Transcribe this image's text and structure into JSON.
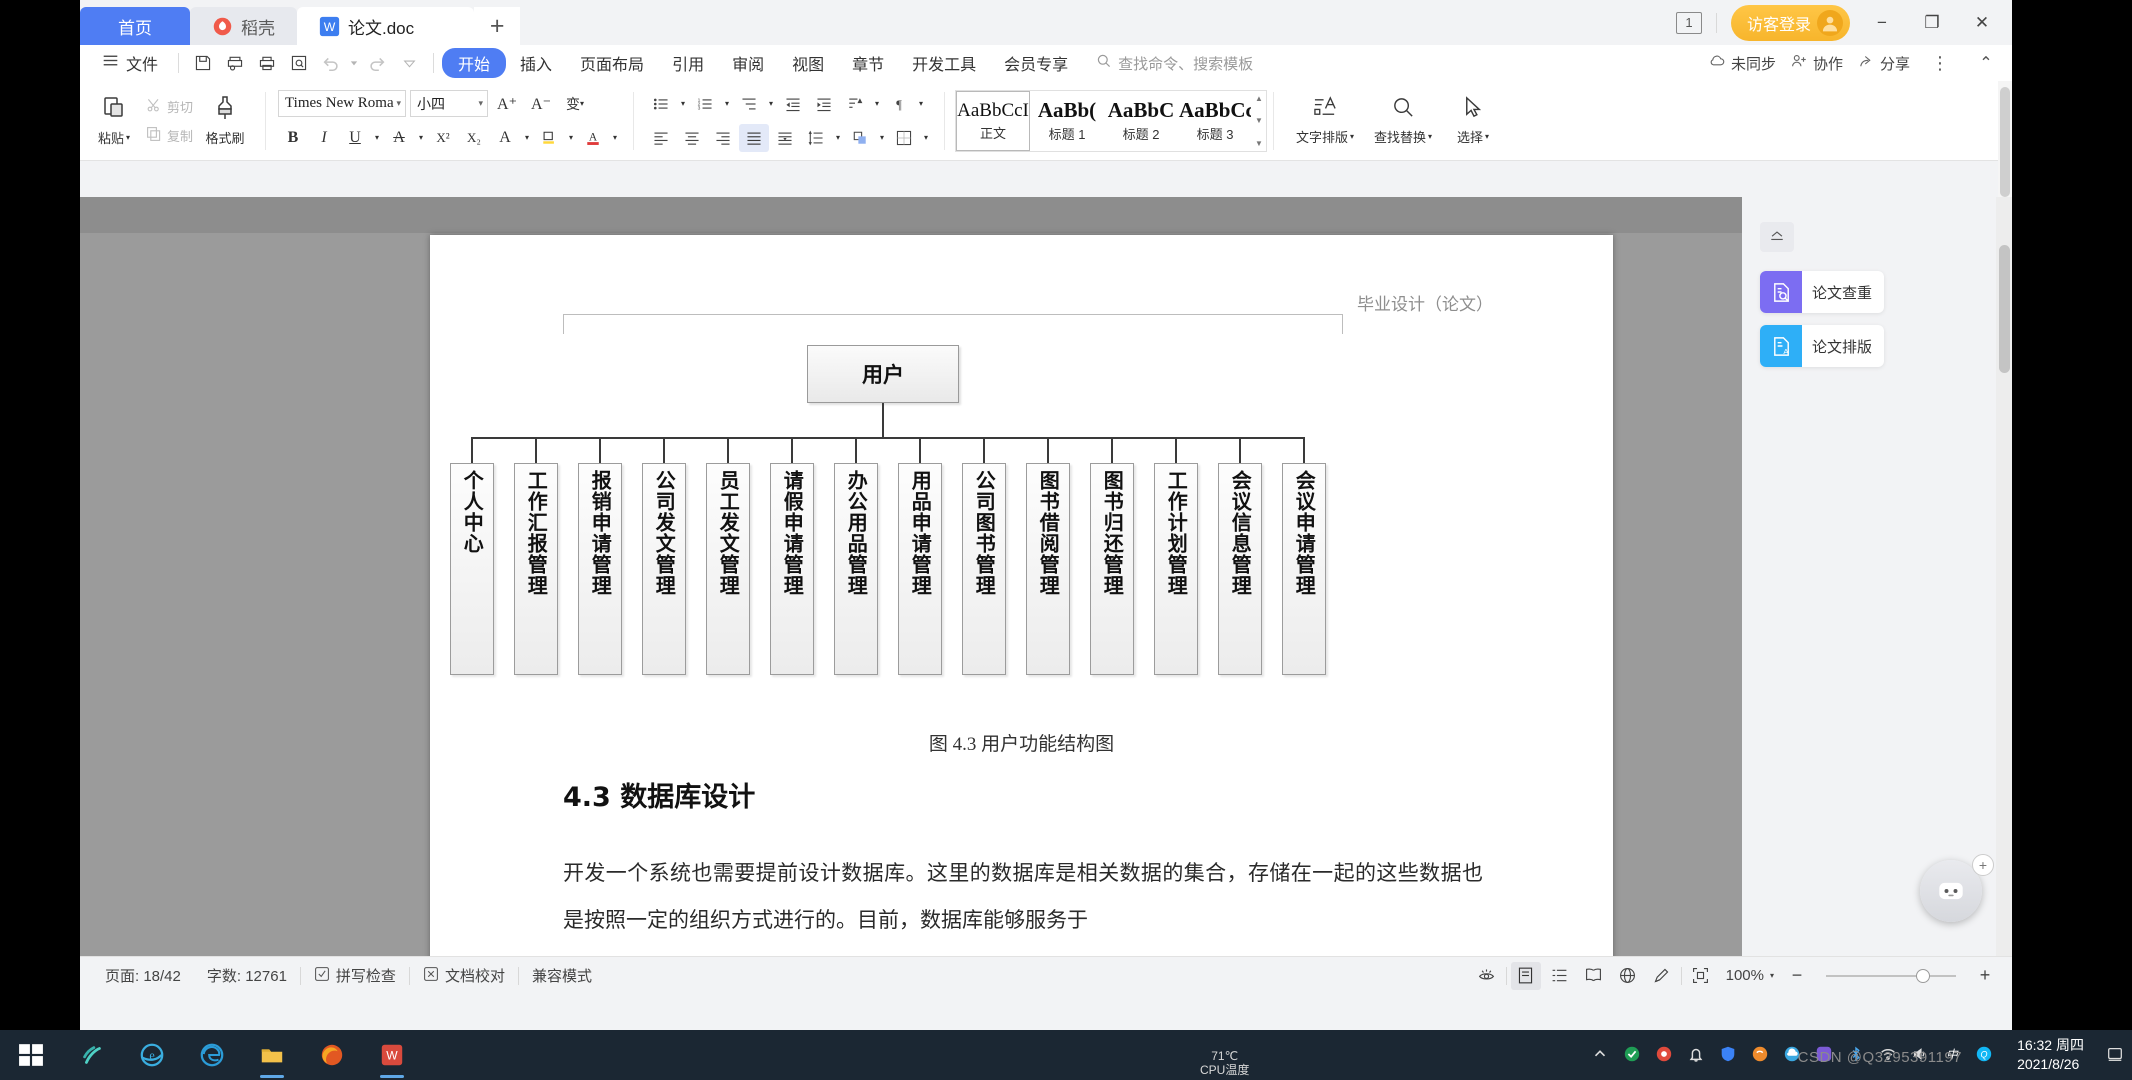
{
  "window": {
    "tabs": [
      {
        "label": "首页",
        "type": "home",
        "icon": "home-tab"
      },
      {
        "label": "稻壳",
        "type": "docer",
        "icon": "docer-icon"
      },
      {
        "label": "论文.doc",
        "type": "doc",
        "icon": "wps-writer-icon"
      }
    ],
    "new_tab_label": "+",
    "page_badge": "1",
    "login_label": "访客登录",
    "minimize": "−",
    "restore": "❐",
    "close": "✕"
  },
  "ribbon": {
    "file_menu": "文件",
    "quick_access": [
      "save-icon",
      "print-preview-icon",
      "print-icon",
      "search-doc-icon",
      "undo-icon",
      "redo-icon",
      "customize-qat-icon"
    ],
    "tabs": [
      "开始",
      "插入",
      "页面布局",
      "引用",
      "审阅",
      "视图",
      "章节",
      "开发工具",
      "会员专享"
    ],
    "active_tab": "开始",
    "search_placeholder": "查找命令、搜索模板",
    "right_actions": [
      {
        "label": "未同步",
        "icon": "cloud-sync-icon"
      },
      {
        "label": "协作",
        "icon": "collaborate-icon"
      },
      {
        "label": "分享",
        "icon": "share-icon"
      }
    ],
    "overflow": "⋮",
    "collapse": "⌃"
  },
  "home_tab": {
    "paste": "粘贴",
    "cut": "剪切",
    "copy": "复制",
    "format_painter": "格式刷",
    "font_name": "Times New Roma",
    "font_size": "小四",
    "grow_font": "A⁺",
    "shrink_font": "A⁻",
    "change_case": "变",
    "bold": "B",
    "italic": "I",
    "underline": "U",
    "strikethrough": "A",
    "superscript": "X²",
    "subscript": "X₂",
    "clear_format": "A",
    "highlight": "A",
    "font_color": "A",
    "bullets": "bullet-list-icon",
    "numbering": "numbered-list-icon",
    "multilevel": "multilevel-list-icon",
    "decrease_indent": "decrease-indent-icon",
    "increase_indent": "increase-indent-icon",
    "sort": "sort-icon",
    "show_marks": "show-paragraph-marks-icon",
    "align_left": "align-left-icon",
    "align_center": "align-center-icon",
    "align_right": "align-right-icon",
    "justify": "justify-icon",
    "distribute": "distribute-icon",
    "line_spacing": "line-spacing-icon",
    "shading": "shading-icon",
    "borders": "borders-icon"
  },
  "styles": {
    "items": [
      {
        "preview": "AaBbCcI",
        "label": "正文",
        "bold": false,
        "selected": true
      },
      {
        "preview": "AaBb(",
        "label": "标题 1",
        "bold": true,
        "selected": false
      },
      {
        "preview": "AaBbC",
        "label": "标题 2",
        "bold": true,
        "selected": false
      },
      {
        "preview": "AaBbCcI",
        "label": "标题 3",
        "bold": true,
        "selected": false
      }
    ]
  },
  "right_group": [
    {
      "label": "文字排版",
      "icon": "text-typeset-icon"
    },
    {
      "label": "查找替换",
      "icon": "find-replace-icon"
    },
    {
      "label": "选择",
      "icon": "select-cursor-icon"
    }
  ],
  "document": {
    "header_text": "毕业设计（论文）",
    "figure_caption": "图 4.3  用户功能结构图",
    "heading": "4.3  数据库设计",
    "paragraph": "开发一个系统也需要提前设计数据库。这里的数据库是相关数据的集合，存储在一起的这些数据也是按照一定的组织方式进行的。目前，数据库能够服务于",
    "chart_data": {
      "type": "diagram",
      "title": "用户功能结构图",
      "root": "用户",
      "children": [
        "个人中心",
        "工作汇报管理",
        "报销申请管理",
        "公司发文管理",
        "员工发文管理",
        "请假申请管理",
        "办公用品管理",
        "用品申请管理",
        "公司图书管理",
        "图书借阅管理",
        "图书归还管理",
        "工作计划管理",
        "会议信息管理",
        "会议申请管理"
      ]
    }
  },
  "task_panel": {
    "collapse_icon": "collapse-panel-icon",
    "cards": [
      {
        "label": "论文查重",
        "icon": "plagiarism-check-icon",
        "color": "#7c6df2"
      },
      {
        "label": "论文排版",
        "icon": "thesis-format-icon",
        "color": "#2eaff7"
      }
    ]
  },
  "status_bar": {
    "page": "页面: 18/42",
    "words": "字数: 12761",
    "spell_check": "拼写检查",
    "doc_proofread": "文档校对",
    "compat_mode": "兼容模式",
    "view_icons": [
      "eye-protection-icon",
      "page-view-icon",
      "outline-view-icon",
      "reading-view-icon",
      "web-view-icon",
      "edit-pen-icon",
      "fit-page-icon"
    ],
    "zoom_label": "100%",
    "zoom_out": "−",
    "zoom_in": "+"
  },
  "taskbar": {
    "start": "start-icon",
    "items": [
      "smartphone-link-icon",
      "ie-icon",
      "edge-icon",
      "file-explorer-icon",
      "firefox-icon",
      "wps-writer-icon"
    ],
    "cpu_label": "CPU温度",
    "cpu_value": "71℃",
    "tray": [
      "chevron-up-icon",
      "antivirus-icon",
      "tencent-icon",
      "bell-icon",
      "shield-icon",
      "sogou-icon",
      "cloud-icon",
      "app-icon",
      "bluetooth-icon",
      "wifi-icon",
      "volume-icon",
      "ime-cn-icon",
      "qq-icon"
    ],
    "clock_time": "16:32 周四",
    "clock_date": "2021/8/26"
  },
  "watermark": "CSDN @Q3295391197",
  "colors": {
    "accent_blue": "#4f7df3",
    "login_orange": "#f7b52c",
    "taskbar_bg": "#1b2733",
    "doc_bg": "#9b9b9b"
  }
}
